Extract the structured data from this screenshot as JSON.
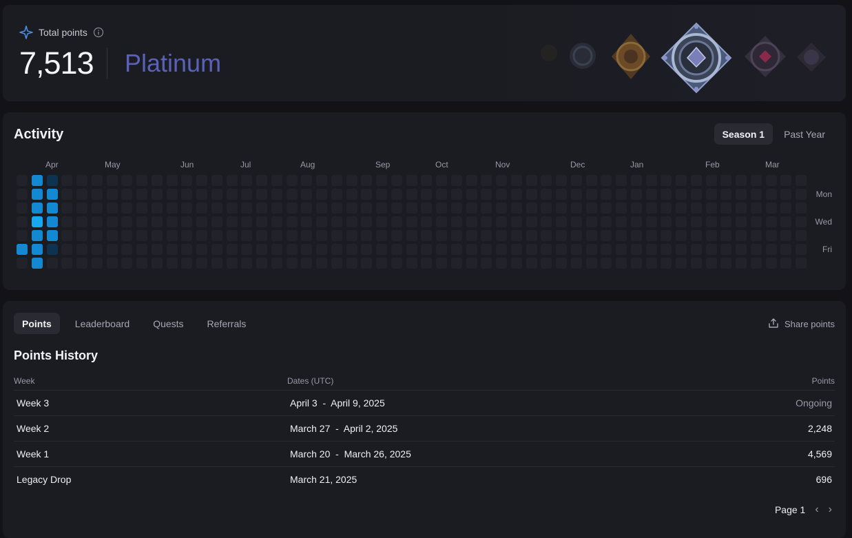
{
  "summary": {
    "label": "Total points",
    "value": "7,513",
    "tier": "Platinum",
    "tier_color": "#5a62b8",
    "accent_icon": "sparkle-icon",
    "info_icon": "info-icon"
  },
  "activity": {
    "title": "Activity",
    "range_options": [
      "Season 1",
      "Past Year"
    ],
    "selected_range": "Season 1",
    "months": [
      "Apr",
      "May",
      "Jun",
      "Jul",
      "Aug",
      "Sep",
      "Oct",
      "Nov",
      "Dec",
      "Jan",
      "Feb",
      "Mar"
    ],
    "day_labels": [
      "Mon",
      "Wed",
      "Fri"
    ],
    "weeks": 53,
    "active_cells": [
      {
        "week": 0,
        "day": 5,
        "level": 3
      },
      {
        "week": 1,
        "day": 0,
        "level": 3
      },
      {
        "week": 1,
        "day": 1,
        "level": 3
      },
      {
        "week": 1,
        "day": 2,
        "level": 3
      },
      {
        "week": 1,
        "day": 3,
        "level": 4
      },
      {
        "week": 1,
        "day": 4,
        "level": 3
      },
      {
        "week": 1,
        "day": 5,
        "level": 3
      },
      {
        "week": 1,
        "day": 6,
        "level": 3
      },
      {
        "week": 2,
        "day": 0,
        "level": 1
      },
      {
        "week": 2,
        "day": 1,
        "level": 3
      },
      {
        "week": 2,
        "day": 2,
        "level": 3
      },
      {
        "week": 2,
        "day": 3,
        "level": 3
      },
      {
        "week": 2,
        "day": 4,
        "level": 3
      },
      {
        "week": 2,
        "day": 5,
        "level": 1
      }
    ],
    "level_colors": {
      "0": "#22222a",
      "1": "#0e3350",
      "2": "#0e5c90",
      "3": "#1389d4",
      "4": "#18a8ee"
    }
  },
  "points": {
    "tabs": [
      "Points",
      "Leaderboard",
      "Quests",
      "Referrals"
    ],
    "active_tab": "Points",
    "share_label": "Share points",
    "history_title": "Points History",
    "columns": [
      "Week",
      "Dates (UTC)",
      "Points"
    ],
    "rows": [
      {
        "week": "Week 3",
        "dates": "April 3  -  April 9, 2025",
        "points": "Ongoing"
      },
      {
        "week": "Week 2",
        "dates": "March 27  -  April 2, 2025",
        "points": "2,248"
      },
      {
        "week": "Week 1",
        "dates": "March 20  -  March 26, 2025",
        "points": "4,569"
      },
      {
        "week": "Legacy Drop",
        "dates": "March 21, 2025",
        "points": "696"
      }
    ],
    "page_label": "Page 1"
  }
}
